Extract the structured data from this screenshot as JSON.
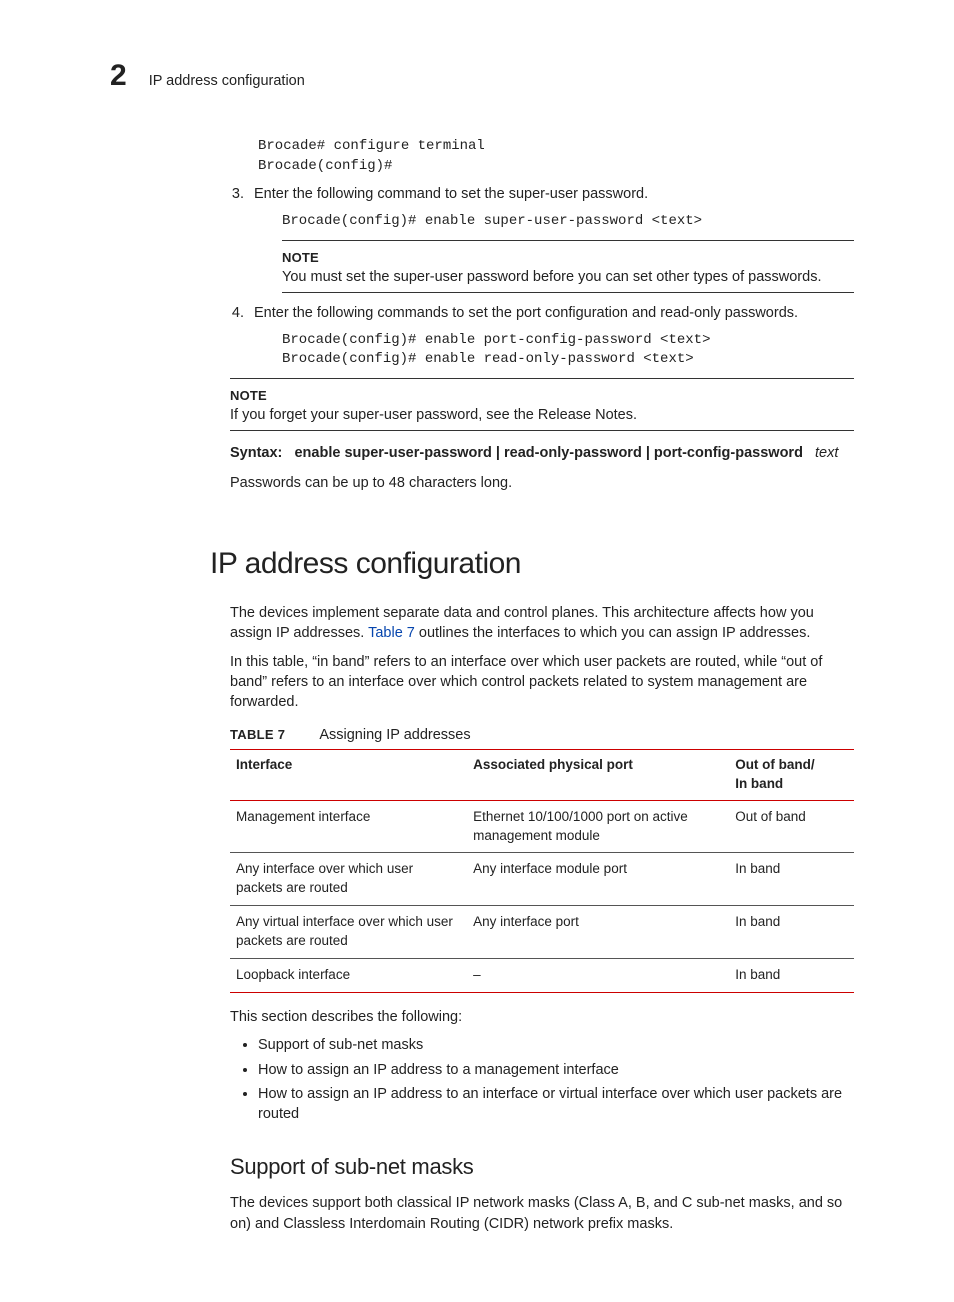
{
  "header": {
    "chapter_number": "2",
    "running_title": "IP address configuration"
  },
  "pre_steps_code": "Brocade# configure terminal\nBrocade(config)#",
  "steps": [
    {
      "text": "Enter the following command to set the super-user password.",
      "code": "Brocade(config)# enable super-user-password <text>",
      "note": {
        "label": "NOTE",
        "body": "You must set the super-user password before you can set other types of passwords."
      }
    },
    {
      "text": "Enter the following commands to set the port configuration and read-only passwords.",
      "code": "Brocade(config)# enable port-config-password <text>\nBrocade(config)# enable read-only-password <text>"
    }
  ],
  "outer_note": {
    "label": "NOTE",
    "body": "If you forget your super-user password, see the Release Notes."
  },
  "syntax": {
    "label": "Syntax:",
    "command": "enable super-user-password | read-only-password | port-config-password",
    "arg": "text"
  },
  "after_syntax": "Passwords can be up to 48 characters long.",
  "section_heading": "IP address configuration",
  "section_p1_a": "The devices implement separate data and control planes. This architecture affects how you assign IP addresses. ",
  "section_p1_link": "Table 7",
  "section_p1_b": " outlines the interfaces to which you can assign IP addresses.",
  "section_p2": "In this table, “in band” refers to an interface over which user packets are routed, while “out of band” refers to an interface over which control packets related to system management are forwarded.",
  "table": {
    "label": "TABLE 7",
    "caption": "Assigning IP addresses",
    "headers": [
      "Interface",
      "Associated physical port",
      "Out of band/\nIn band"
    ],
    "rows": [
      [
        "Management interface",
        "Ethernet 10/100/1000 port on active management module",
        "Out of band"
      ],
      [
        "Any interface over which user packets are routed",
        "Any interface module port",
        "In band"
      ],
      [
        "Any virtual interface over which user packets are routed",
        "Any interface port",
        "In band"
      ],
      [
        "Loopback interface",
        "–",
        "In band"
      ]
    ]
  },
  "after_table_intro": "This section describes the following:",
  "bullets": [
    "Support of sub-net masks",
    "How to assign an IP address to a management interface",
    "How to assign an IP address to an interface or virtual interface over which user packets are routed"
  ],
  "subsection_heading": "Support of sub-net masks",
  "subsection_p1": "The devices support both classical IP network masks (Class A, B, and C sub-net masks, and so on) and Classless Interdomain Routing (CIDR) network prefix masks."
}
